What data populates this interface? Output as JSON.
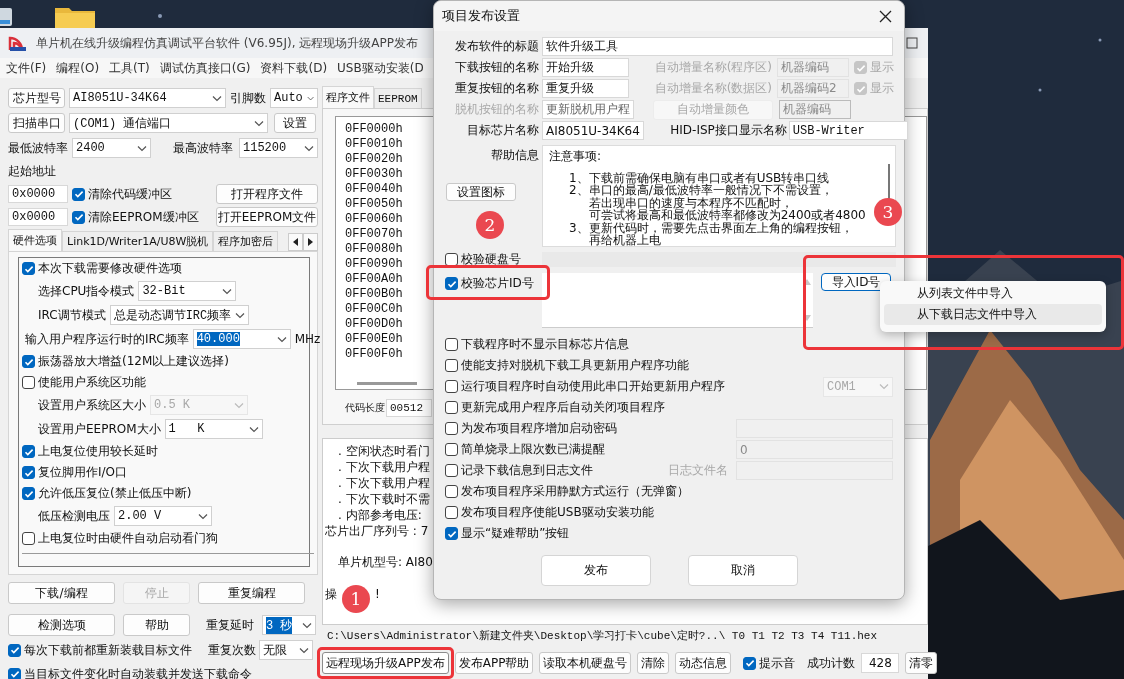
{
  "main_window": {
    "title": "单片机在线升级编程仿真调试平台软件 (V6.95J), 远程现场升级APP发布",
    "menu": [
      "文件(F)",
      "编程(O)",
      "工具(T)",
      "调试仿真接口(G)",
      "资料下载(D)",
      "USB驱动安装(D"
    ],
    "chip": {
      "button": "芯片型号",
      "value": "AI8051U-34K64",
      "pins_label": "引脚数",
      "pins": "Auto"
    },
    "port": {
      "button": "扫描串口",
      "value": "(COM1) 通信端口",
      "settings_button": "设置"
    },
    "baud": {
      "min_label": "最低波特率",
      "min": "2400",
      "max_label": "最高波特率",
      "max": "115200"
    },
    "start_address": {
      "label": "起始地址",
      "rows": [
        {
          "value": "0x0000",
          "checkbox": "清除代码缓冲区",
          "checked": true,
          "button": "打开程序文件"
        },
        {
          "value": "0x0000",
          "checkbox": "清除EEPROM缓冲区",
          "checked": true,
          "button": "打开EEPROM文件"
        }
      ]
    },
    "option_tabs": [
      {
        "label": "硬件选项",
        "selected": true
      },
      {
        "label": "Link1D/Writer1A/U8W脱机",
        "selected": false
      },
      {
        "label": "程序加密后",
        "selected": false
      }
    ],
    "hardware_options": [
      {
        "kind": "check",
        "label": "本次下载需要修改硬件选项",
        "checked": true
      },
      {
        "kind": "select",
        "label": "选择CPU指令模式",
        "value": "32-Bit",
        "disabled": false,
        "highlighted": false
      },
      {
        "kind": "select",
        "label": "IRC调节模式",
        "value": "总是动态调节IRC频率",
        "disabled": false,
        "highlighted": false
      },
      {
        "kind": "select",
        "label": "输入用户程序运行时的IRC频率",
        "value": "40.000",
        "unit": "MHz",
        "disabled": false,
        "highlighted": true
      },
      {
        "kind": "check",
        "label": "振荡器放大增益(12M以上建议选择)",
        "checked": true
      },
      {
        "kind": "check",
        "label": "使能用户系统区功能",
        "checked": false
      },
      {
        "kind": "select",
        "label": "设置用户系统区大小",
        "value": "0.5 K",
        "disabled": true,
        "highlighted": false
      },
      {
        "kind": "select",
        "label": "设置用户EEPROM大小",
        "value": "1   K",
        "disabled": false,
        "highlighted": false
      },
      {
        "kind": "check",
        "label": "上电复位使用较长延时",
        "checked": true
      },
      {
        "kind": "check",
        "label": "复位脚用作I/O口",
        "checked": true
      },
      {
        "kind": "check",
        "label": "允许低压复位(禁止低压中断)",
        "checked": true
      },
      {
        "kind": "select",
        "label": "低压检测电压",
        "value": "2.00 V",
        "disabled": false,
        "highlighted": false
      },
      {
        "kind": "check",
        "label": "上电复位时由硬件自动启动看门狗",
        "checked": false
      }
    ],
    "action_buttons": [
      {
        "label": "下载/编程",
        "disabled": false
      },
      {
        "label": "停止",
        "disabled": true
      },
      {
        "label": "重复编程",
        "disabled": false
      },
      {
        "label": "检测选项",
        "disabled": false
      },
      {
        "label": "帮助",
        "disabled": false
      }
    ],
    "repeat_delay": {
      "label": "重复延时",
      "value": "3 秒",
      "highlighted": true
    },
    "repeat_count": {
      "label": "重复次数",
      "value": "无限"
    },
    "auto_options": [
      {
        "label": "每次下载前都重新装载目标文件",
        "checked": true
      },
      {
        "label": "当目标文件变化时自动装载并发送下载命令",
        "checked": true
      }
    ],
    "file_tabs": [
      {
        "label": "程序文件",
        "selected": true
      },
      {
        "label": "EEPROM",
        "selected": false
      }
    ],
    "hex_addresses": [
      "0FF0000h",
      "0FF0010h",
      "0FF0020h",
      "0FF0030h",
      "0FF0040h",
      "0FF0050h",
      "0FF0060h",
      "0FF0070h",
      "0FF0080h",
      "0FF0090h",
      "0FF00A0h",
      "0FF00B0h",
      "0FF00C0h",
      "0FF00D0h",
      "0FF00E0h",
      "0FF00F0h"
    ],
    "code_length": {
      "label": "代码长度",
      "value": "00512"
    },
    "log": [
      ". 空闲状态时看门",
      ". 下次下载用户程",
      ". 下次下载用户程",
      ". 下次下载时不需",
      ". 内部参考电压:"
    ],
    "serial": "芯片出厂序列号 : 7",
    "model": "单片机型号: AI80",
    "status": {
      "before": "操",
      "after": "!"
    },
    "path": "C:\\Users\\Administrator\\新建文件夹\\Desktop\\学习打卡\\cube\\定时?..\\ T0 T1 T2 T3 T4 T11.hex",
    "bottom_buttons": [
      {
        "label": "远程现场升级APP发布",
        "highlighted": true
      },
      {
        "label": "发布APP帮助",
        "highlighted": false
      },
      {
        "label": "读取本机硬盘号",
        "highlighted": false
      },
      {
        "label": "清除",
        "highlighted": false
      },
      {
        "label": "动态信息",
        "highlighted": false
      }
    ],
    "beep": {
      "label": "提示音",
      "checked": true
    },
    "success_count": {
      "label": "成功计数",
      "value": "428",
      "reset_button": "清零"
    }
  },
  "dialog": {
    "title": "项目发布设置",
    "title_field": {
      "label": "发布软件的标题",
      "value": "软件升级工具"
    },
    "name_rows": [
      {
        "label": "下载按钮的名称",
        "value": "开始升级",
        "disabled": false,
        "extra": {
          "kind": "auto",
          "label": "自动增量名称(程序区)",
          "value": "机器编码",
          "check": "显示",
          "checked": true,
          "disabled": true
        }
      },
      {
        "label": "重复按钮的名称",
        "value": "重复升级",
        "disabled": false,
        "extra": {
          "kind": "auto",
          "label": "自动增量名称(数据区)",
          "value": "机器编码2",
          "check": "显示",
          "checked": true,
          "disabled": true
        }
      },
      {
        "label": "脱机按钮的名称",
        "value": "更新脱机用户程",
        "disabled": true,
        "extra": {
          "kind": "color",
          "button": "自动增量颜色",
          "value": "机器编码",
          "disabled": true
        }
      },
      {
        "label": "目标芯片名称",
        "value": "AI8051U-34K64",
        "disabled": false,
        "extra": {
          "kind": "text",
          "label": "HID-ISP接口显示名称",
          "value": "USB-Writer",
          "disabled": false
        }
      }
    ],
    "help": {
      "label": "帮助信息",
      "heading": "注意事项:",
      "items": [
        {
          "marker": "1、",
          "lines": [
            "下载前需确保电脑有串口或者有USB转串口线"
          ]
        },
        {
          "marker": "2、",
          "lines": [
            "串口的最高/最低波特率一般情况下不需设置，",
            "若出现串口的速度与本程序不匹配时，",
            "可尝试将最高和最低波特率都修改为2400或者4800"
          ]
        },
        {
          "marker": "3、",
          "lines": [
            "更新代码时，需要先点击界面左上角的编程按钮，",
            "再给机器上电"
          ]
        }
      ],
      "button": "设置图标"
    },
    "verify_disk": {
      "label": "校验硬盘号",
      "checked": false
    },
    "verify_chip": {
      "label": "校验芯片ID号",
      "checked": true,
      "highlighted": true
    },
    "import_button": {
      "label": "导入ID号",
      "highlighted": true
    },
    "import_menu": [
      {
        "label": "从列表文件中导入",
        "selected": false
      },
      {
        "label": "从下载日志文件中导入",
        "selected": true
      }
    ],
    "options": [
      {
        "label": "下载程序时不显示目标芯片信息",
        "checked": false
      },
      {
        "label": "使能支持对脱机下载工具更新用户程序功能",
        "checked": false
      },
      {
        "label": "运行项目程序时自动使用此串口开始更新用户程序",
        "checked": false,
        "extra": {
          "kind": "select",
          "value": "COM1",
          "disabled": true
        }
      },
      {
        "label": "更新完成用户程序后自动关闭项目程序",
        "checked": false
      },
      {
        "label": "为发布项目程序增加启动密码",
        "checked": false,
        "extra": {
          "kind": "field",
          "disabled": true
        }
      },
      {
        "label": "简单烧录上限次数已满提醒",
        "checked": false,
        "extra": {
          "kind": "field",
          "value": "0",
          "disabled": true
        }
      },
      {
        "label": "记录下载信息到日志文件",
        "checked": false,
        "extra": {
          "kind": "field",
          "label": "日志文件名",
          "disabled": true
        }
      },
      {
        "label": "发布项目程序采用静默方式运行（无弹窗）",
        "checked": false
      },
      {
        "label": "发布项目程序使能USB驱动安装功能",
        "checked": false
      },
      {
        "label": "显示“疑难帮助”按钮",
        "checked": true
      }
    ],
    "buttons": [
      "发布",
      "取消"
    ]
  },
  "annotations": {
    "badges": [
      "1",
      "2",
      "3"
    ]
  }
}
